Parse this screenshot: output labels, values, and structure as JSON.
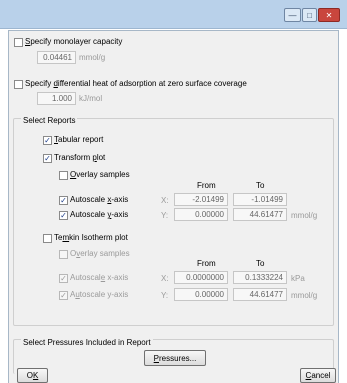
{
  "window": {
    "minimize_glyph": "—",
    "maximize_glyph": "□",
    "close_glyph": "✕"
  },
  "monolayer": {
    "checkbox_label_u": "S",
    "checkbox_label_rest": "pecify monolayer capacity",
    "value": "0.04461",
    "unit": "mmol/g"
  },
  "diffheat": {
    "checkbox_label_pre": "Specify ",
    "checkbox_label_u": "d",
    "checkbox_label_rest": "ifferential heat of adsorption at zero surface coverage",
    "value": "1.000",
    "unit": "kJ/mol"
  },
  "reports": {
    "group_title": "Select Reports",
    "tabular": {
      "u": "T",
      "rest": "abular report",
      "checked": true
    },
    "transform": {
      "pre": "Transform ",
      "u": "p",
      "rest": "lot",
      "checked": true,
      "overlay": {
        "u": "O",
        "rest": "verlay samples",
        "checked": false
      },
      "col_from": "From",
      "col_to": "To",
      "autox": {
        "pre": "Autoscale ",
        "u": "x",
        "rest": "-axis",
        "checked": true,
        "axis": "X:",
        "from": "-2.01499",
        "to": "-1.01499",
        "unit": ""
      },
      "autoy": {
        "pre": "Autoscale ",
        "u": "y",
        "rest": "-axis",
        "checked": true,
        "axis": "Y:",
        "from": "0.00000",
        "to": "44.61477",
        "unit": "mmol/g"
      }
    },
    "temkin": {
      "pre": "Te",
      "u": "m",
      "rest": "kin Isotherm plot",
      "checked": false,
      "overlay": {
        "pre": "O",
        "u": "v",
        "rest": "erlay samples",
        "checked": false
      },
      "col_from": "From",
      "col_to": "To",
      "autox": {
        "pre": "Autoscal",
        "u": "e",
        "rest": " x-axis",
        "checked": true,
        "axis": "X:",
        "from": "0.0000000",
        "to": "0.1333224",
        "unit": "kPa"
      },
      "autoy": {
        "pre": "A",
        "u": "u",
        "rest": "toscale y-axis",
        "checked": true,
        "axis": "Y:",
        "from": "0.00000",
        "to": "44.61477",
        "unit": "mmol/g"
      }
    }
  },
  "pressures": {
    "group_title": "Select Pressures Included in Report",
    "button_u": "P",
    "button_rest": "ressures..."
  },
  "footer": {
    "ok_u": "K",
    "ok_pre": "O",
    "cancel_u": "C",
    "cancel_rest": "ancel"
  },
  "colors": {
    "titlebar": "#b9d1ea",
    "panel": "#f0f0f0",
    "check": "#1f3f8a"
  }
}
